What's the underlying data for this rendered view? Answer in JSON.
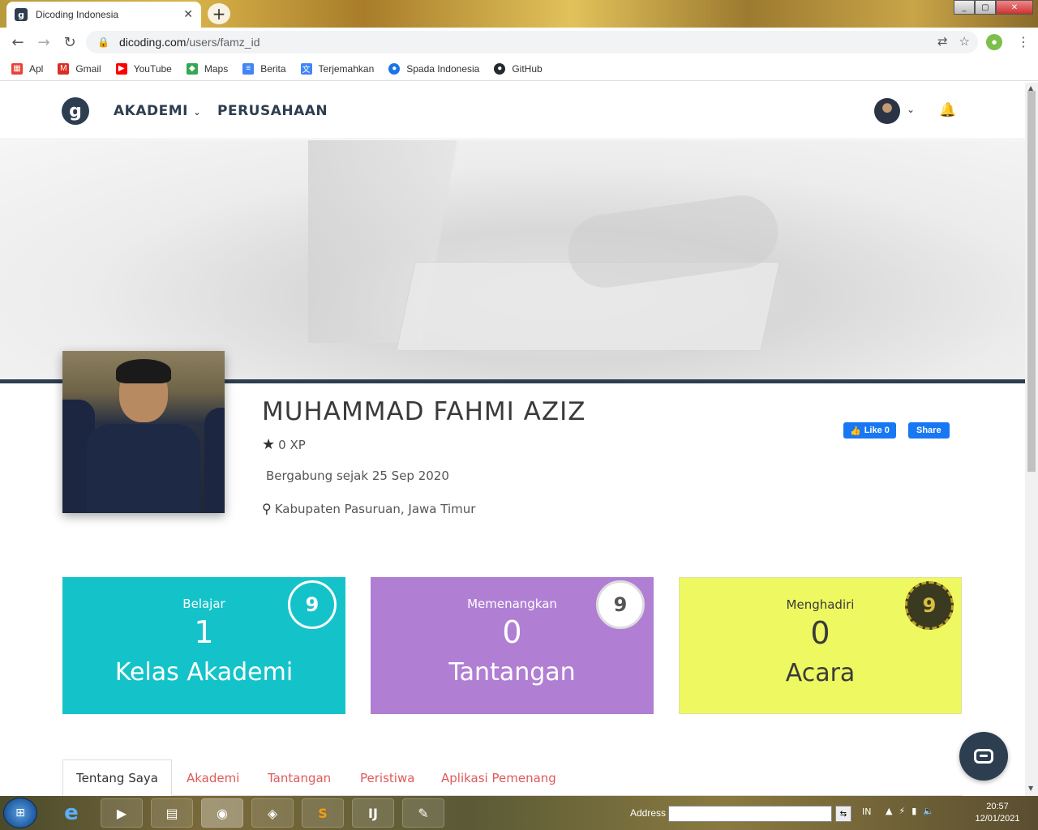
{
  "browser": {
    "tab_title": "Dicoding Indonesia",
    "tab_close": "✕",
    "new_tab": "+",
    "url_host": "dicoding.com",
    "url_path": "/users/famz_id",
    "bookmarks": [
      {
        "label": "Apl",
        "icon": "apps-grid-icon",
        "color": "#e94235"
      },
      {
        "label": "Gmail",
        "icon": "gmail-icon",
        "color": "#d93025"
      },
      {
        "label": "YouTube",
        "icon": "youtube-icon",
        "color": "#ff0000"
      },
      {
        "label": "Maps",
        "icon": "maps-icon",
        "color": "#34a853"
      },
      {
        "label": "Berita",
        "icon": "news-icon",
        "color": "#4285f4"
      },
      {
        "label": "Terjemahkan",
        "icon": "translate-icon",
        "color": "#4285f4"
      },
      {
        "label": "Spada Indonesia",
        "icon": "spada-icon",
        "color": "#1a73e8"
      },
      {
        "label": "GitHub",
        "icon": "github-icon",
        "color": "#24292e"
      }
    ]
  },
  "site": {
    "logo_glyph": "g",
    "menu_akademi": "AKADEMI",
    "menu_perusahaan": "PERUSAHAAN"
  },
  "profile": {
    "name": "MUHAMMAD FAHMI AZIZ",
    "xp": "0 XP",
    "joined": "Bergabung sejak 25 Sep 2020",
    "location": "Kabupaten Pasuruan, Jawa Timur",
    "fb_like": "Like 0",
    "fb_share": "Share"
  },
  "stats": [
    {
      "label": "Belajar",
      "count": "1",
      "sub": "Kelas Akademi",
      "bg": "#14c3c9",
      "fg": "#ffffff",
      "badge": "academy-badge-icon"
    },
    {
      "label": "Memenangkan",
      "count": "0",
      "sub": "Tantangan",
      "bg": "#b07fd3",
      "fg": "#ffffff",
      "badge": "challenge-badge-icon"
    },
    {
      "label": "Menghadiri",
      "count": "0",
      "sub": "Acara",
      "bg": "#eef861",
      "fg": "#3a3a3a",
      "badge": "event-badge-icon"
    }
  ],
  "tabs": [
    "Tentang Saya",
    "Akademi",
    "Tantangan",
    "Peristiwa",
    "Aplikasi Pemenang"
  ],
  "taskbar": {
    "address_label": "Address",
    "lang": "IN",
    "time": "20:57",
    "date": "12/01/2021"
  }
}
